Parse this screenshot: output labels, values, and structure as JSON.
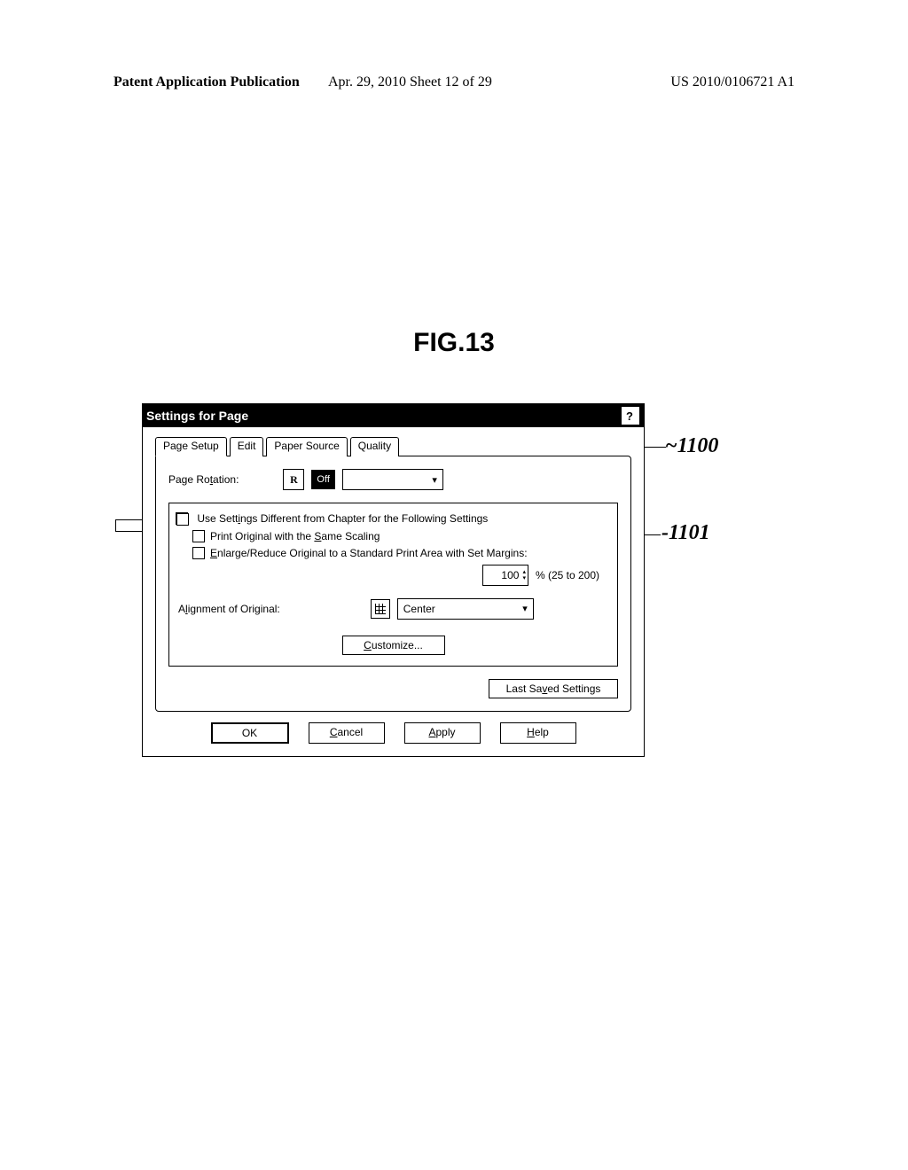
{
  "header": {
    "left": "Patent Application Publication",
    "center": "Apr. 29, 2010  Sheet 12 of 29",
    "right": "US 2010/0106721 A1"
  },
  "figure_label": "FIG.13",
  "callouts": {
    "ref1": "1100",
    "ref2": "1101"
  },
  "dialog": {
    "title": "Settings for Page",
    "help_button": "?",
    "tabs": {
      "t0": "Page Setup",
      "t1": "Edit",
      "t2": "Paper Source",
      "t3": "Quality"
    },
    "rotation_label_pre": "Page Ro",
    "rotation_label_u": "t",
    "rotation_label_post": "ation:",
    "rotation_icon": "R",
    "rotation_value": "Off",
    "group": {
      "use_diff_pre": "Use Sett",
      "use_diff_u": "i",
      "use_diff_post": "ngs Different from Chapter for the Following Settings",
      "same_scaling_pre": "Print Original with the ",
      "same_scaling_u": "S",
      "same_scaling_post": "ame Scaling",
      "enlarge_u": "E",
      "enlarge_post": "nlarge/Reduce Original to a Standard Print Area with Set Margins:",
      "scale_value": "100",
      "scale_range": "% (25 to 200)",
      "align_label_pre": "A",
      "align_label_u": "l",
      "align_label_post": "ignment of Original:",
      "align_value": "Center",
      "customize_u": "C",
      "customize_post": "ustomize..."
    },
    "last_saved_pre": "Last Sa",
    "last_saved_u": "v",
    "last_saved_post": "ed Settings",
    "buttons": {
      "ok": "OK",
      "cancel_u": "C",
      "cancel_post": "ancel",
      "apply_u": "A",
      "apply_post": "pply",
      "help_u": "H",
      "help_post": "elp"
    }
  }
}
